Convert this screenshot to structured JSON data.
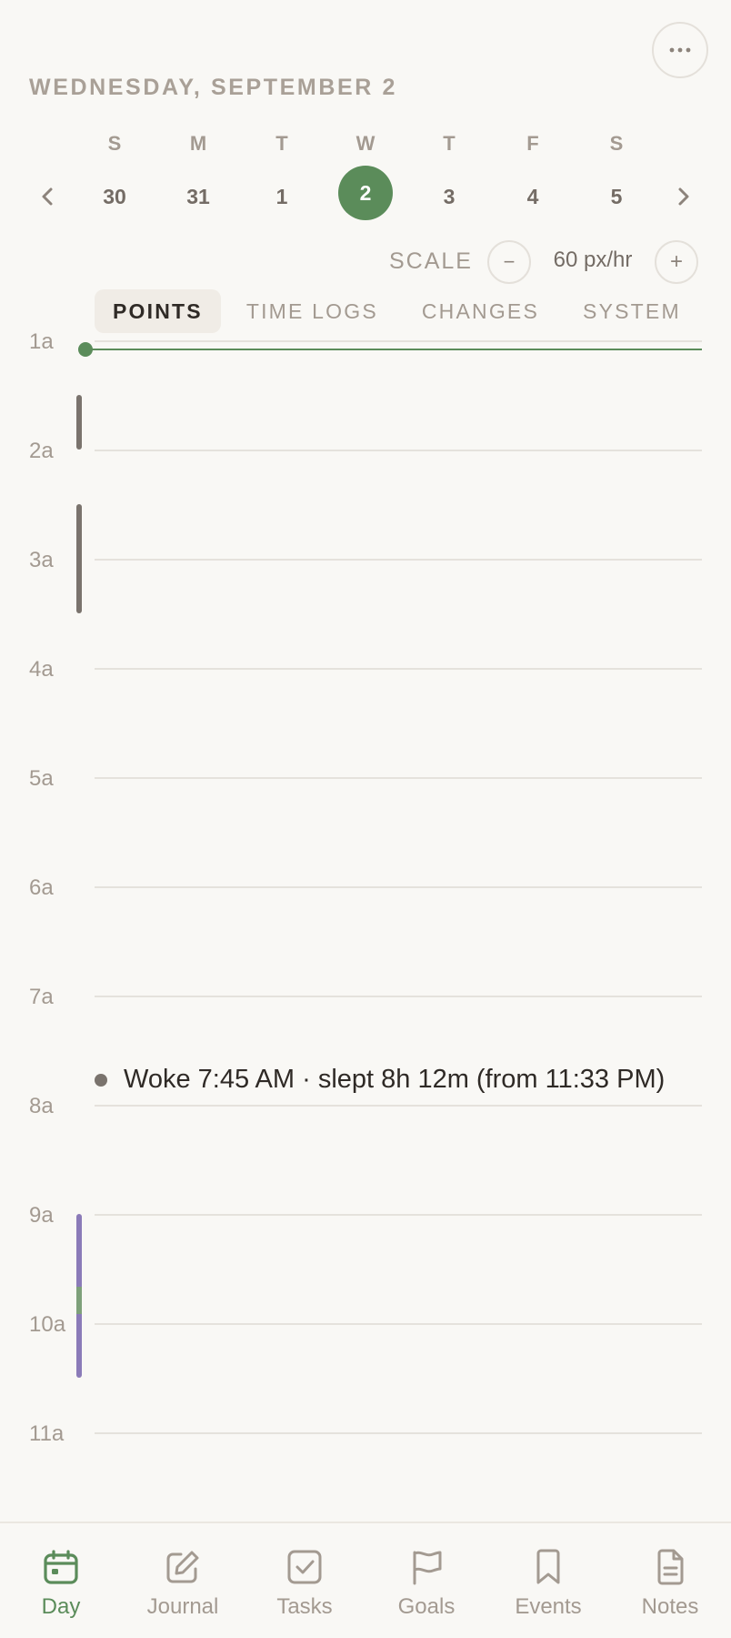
{
  "header": {
    "date_heading": "WEDNESDAY, SEPTEMBER 2",
    "more_icon": "more-horizontal-icon"
  },
  "week": {
    "prev_icon": "chevron-left-icon",
    "next_icon": "chevron-right-icon",
    "days": [
      {
        "dow": "S",
        "num": "30",
        "selected": false
      },
      {
        "dow": "M",
        "num": "31",
        "selected": false
      },
      {
        "dow": "T",
        "num": "1",
        "selected": false
      },
      {
        "dow": "W",
        "num": "2",
        "selected": true
      },
      {
        "dow": "T",
        "num": "3",
        "selected": false
      },
      {
        "dow": "F",
        "num": "4",
        "selected": false
      },
      {
        "dow": "S",
        "num": "5",
        "selected": false
      }
    ]
  },
  "scale": {
    "label": "SCALE",
    "value": "60 px/hr",
    "decrease_label": "−",
    "increase_label": "+"
  },
  "tabs": [
    {
      "label": "POINTS",
      "active": true
    },
    {
      "label": "TIME LOGS",
      "active": false
    },
    {
      "label": "CHANGES",
      "active": false
    },
    {
      "label": "SYSTEM",
      "active": false
    }
  ],
  "timeline": {
    "hours": [
      "1a",
      "2a",
      "3a",
      "4a",
      "5a",
      "6a",
      "7a",
      "8a",
      "9a",
      "10a",
      "11a"
    ],
    "events": [
      {
        "text": "Woke 7:45 AM · slept 8h 12m (from 11:33 PM)"
      }
    ]
  },
  "colors": {
    "accent": "#5b8c5a",
    "bar_gray": "#7a736d",
    "bar_purple": "#8b7bb8"
  },
  "bottom_nav": [
    {
      "label": "Day",
      "icon": "calendar-icon",
      "active": true
    },
    {
      "label": "Journal",
      "icon": "edit-icon",
      "active": false
    },
    {
      "label": "Tasks",
      "icon": "checkbox-icon",
      "active": false
    },
    {
      "label": "Goals",
      "icon": "flag-icon",
      "active": false
    },
    {
      "label": "Events",
      "icon": "bookmark-icon",
      "active": false
    },
    {
      "label": "Notes",
      "icon": "document-icon",
      "active": false
    }
  ]
}
